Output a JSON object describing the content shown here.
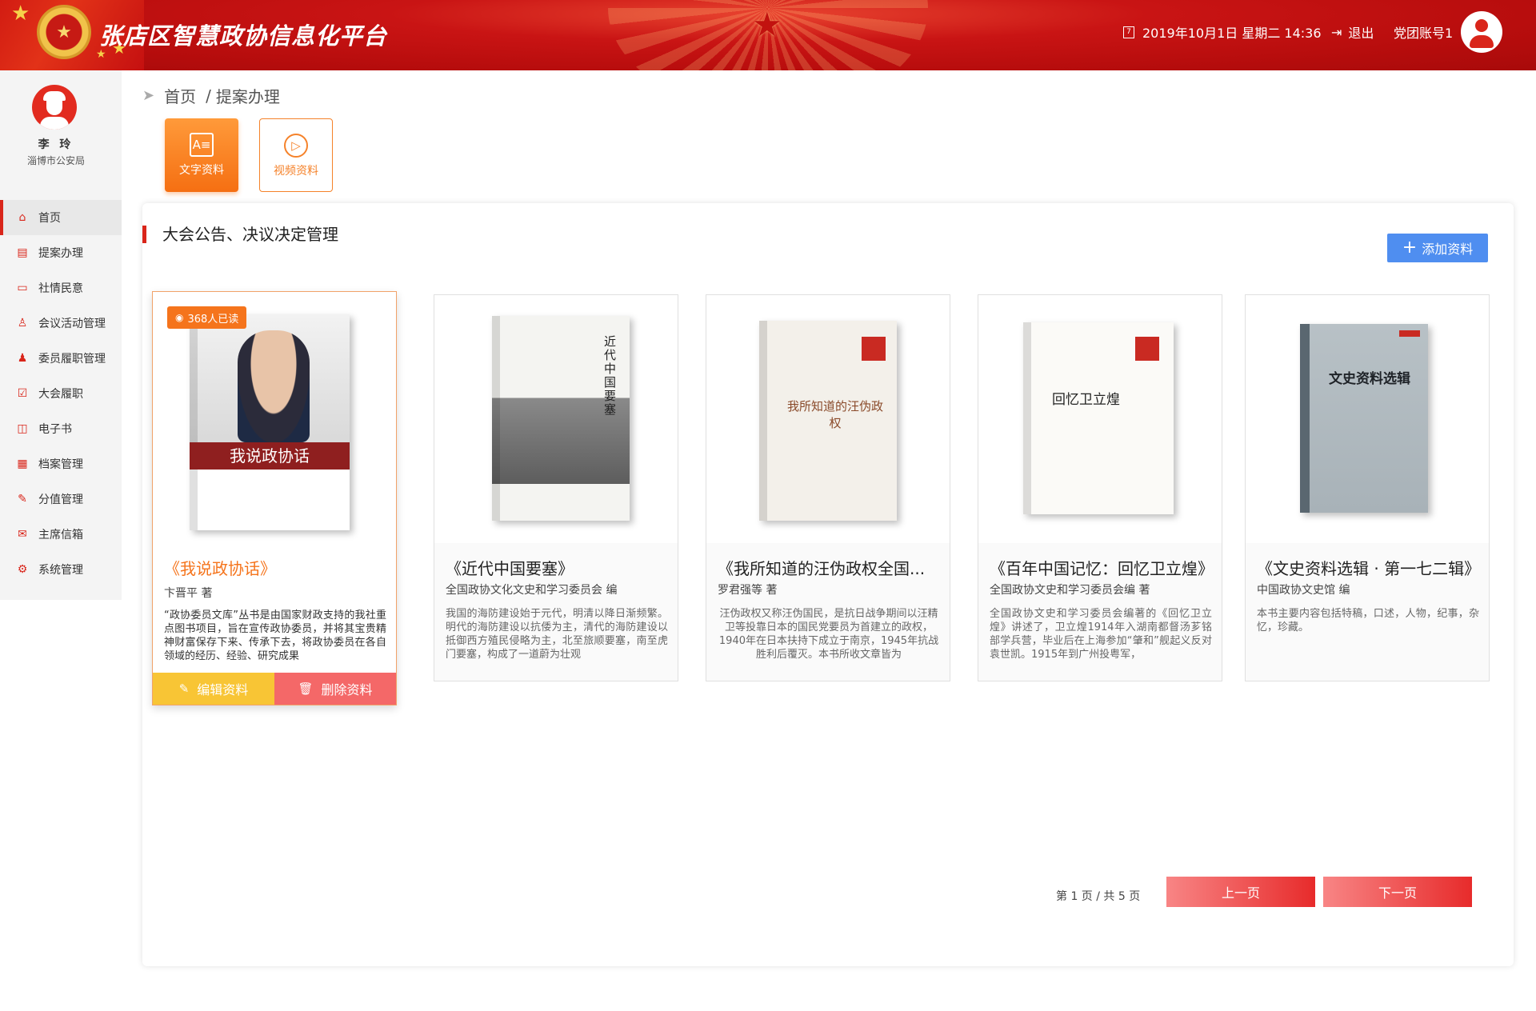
{
  "header": {
    "title": "张店区智慧政协信息化平台",
    "datetime": "2019年10月1日 星期二 14:36",
    "logout_label": "退出",
    "account_label": "党团账号1"
  },
  "profile": {
    "name": "李 玲",
    "org": "淄博市公安局"
  },
  "sidebar": {
    "items": [
      {
        "label": "首页",
        "icon": "home-icon"
      },
      {
        "label": "提案办理",
        "icon": "proposal-icon"
      },
      {
        "label": "社情民意",
        "icon": "chat-icon"
      },
      {
        "label": "会议活动管理",
        "icon": "people-icon"
      },
      {
        "label": "委员履职管理",
        "icon": "user-icon"
      },
      {
        "label": "大会履职",
        "icon": "clipboard-icon"
      },
      {
        "label": "电子书",
        "icon": "book-icon"
      },
      {
        "label": "档案管理",
        "icon": "archive-icon"
      },
      {
        "label": "分值管理",
        "icon": "score-icon"
      },
      {
        "label": "主席信箱",
        "icon": "mail-icon"
      },
      {
        "label": "系统管理",
        "icon": "gear-icon"
      }
    ],
    "active_index": 0
  },
  "breadcrumb": {
    "home": "首页",
    "current": "提案办理"
  },
  "type_tabs": [
    {
      "label": "文字资料",
      "icon": "text-doc-icon",
      "active": true
    },
    {
      "label": "视频资料",
      "icon": "play-icon",
      "active": false
    }
  ],
  "panel": {
    "title": "大会公告、决议决定管理",
    "add_label": "添加资料"
  },
  "cards": [
    {
      "title": "《我说政协话》",
      "author": "卞晋平 著",
      "desc": "“政协委员文库”丛书是由国家财政支持的我社重点图书项目，旨在宣传政协委员，并将其宝贵精神财富保存下来、传承下去，将政协委员在各自领域的经历、经验、研究成果",
      "read_badge": "368人已读",
      "edit_label": "编辑资料",
      "delete_label": "删除资料",
      "cover_text": "我说政协话"
    },
    {
      "title": "《近代中国要塞》",
      "author": "全国政协文化文史和学习委员会 编",
      "desc": "我国的海防建设始于元代，明清以降日渐频繁。明代的海防建设以抗倭为主，清代的海防建设以抵御西方殖民侵略为主，北至旅顺要塞，南至虎门要塞，构成了一道蔚为壮观",
      "cover_text": "近代中国要塞"
    },
    {
      "title": "《我所知道的汪伪政权全国全国全国",
      "author": "罗君强等 著",
      "desc": "汪伪政权又称汪伪国民，是抗日战争期间以汪精卫等投靠日本的国民党要员为首建立的政权，1940年在日本扶持下成立于南京，1945年抗战胜利后覆灭。本书所收文章皆为",
      "cover_text": "我所知道的汪伪政权"
    },
    {
      "title": "《百年中国记忆：回忆卫立煌》",
      "author": "全国政协文史和学习委员会编 著",
      "desc": "全国政协文史和学习委员会编著的《回忆卫立煌》讲述了，卫立煌1914年入湖南都督汤芗铭部学兵营，毕业后在上海参加“肇和”舰起义反对袁世凯。1915年到广州投粤军，",
      "cover_text": "回忆卫立煌"
    },
    {
      "title": "《文史资料选辑 · 第一七二辑》",
      "author": "中国政协文史馆 编",
      "desc": "本书主要内容包括特稿，口述，人物，纪事，杂忆，珍藏。",
      "cover_text": "文史资料选辑"
    }
  ],
  "pagination": {
    "info": "第 1 页 / 共 5 页",
    "prev_label": "上一页",
    "next_label": "下一页"
  },
  "colors": {
    "brand_red": "#d9251a",
    "orange": "#f5741c",
    "blue": "#4f8ef0",
    "yellow": "#f8c535",
    "pink_red": "#f46868"
  }
}
